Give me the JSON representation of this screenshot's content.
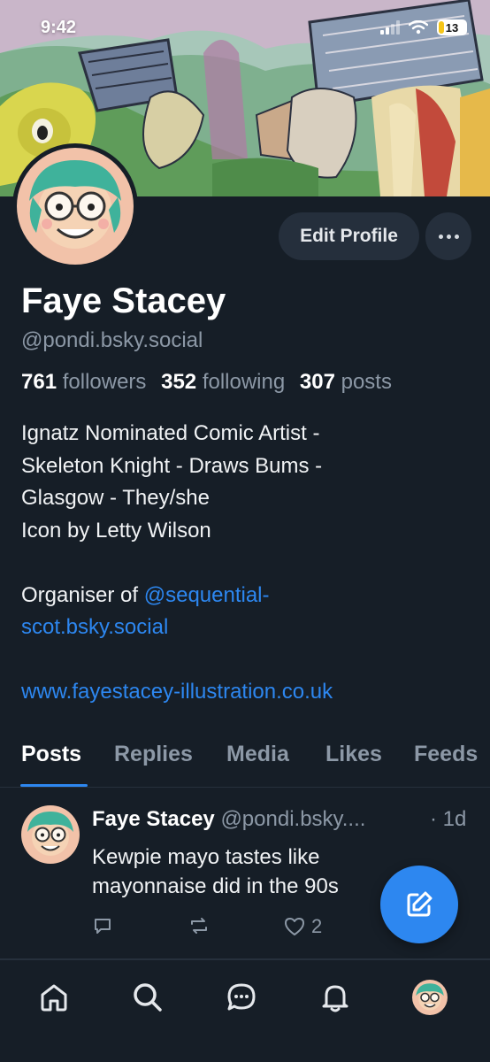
{
  "status_bar": {
    "time": "9:42",
    "battery": "13"
  },
  "profile": {
    "name": "Faye Stacey",
    "handle": "@pondi.bsky.social",
    "followers_count": "761",
    "followers_label": "followers",
    "following_count": "352",
    "following_label": "following",
    "posts_count": "307",
    "posts_label": "posts",
    "edit_button": "Edit Profile",
    "bio": {
      "line1": "Ignatz Nominated Comic Artist -",
      "line2": "Skeleton Knight - Draws Bums -",
      "line3": "Glasgow - They/she",
      "line4": "Icon by Letty Wilson",
      "organiser_prefix": "Organiser of ",
      "organiser_link_part1": "@sequential-",
      "organiser_link_part2": "scot.bsky.social",
      "website": "www.fayestacey-illustration.co.uk"
    }
  },
  "tabs": [
    {
      "label": "Posts",
      "active": true
    },
    {
      "label": "Replies"
    },
    {
      "label": "Media"
    },
    {
      "label": "Likes"
    },
    {
      "label": "Feeds"
    }
  ],
  "post": {
    "author": "Faye Stacey",
    "handle": "@pondi.bsky....",
    "time": "· 1d",
    "line1": "Kewpie mayo tastes like",
    "line2": "mayonnaise did in the 90s",
    "likes": "2"
  },
  "colors": {
    "background": "#161e27",
    "accent": "#2d87f0",
    "muted": "#8c98a6",
    "button_bg": "#252f3c"
  },
  "icons": {
    "nav": [
      "home-icon",
      "search-icon",
      "chat-icon",
      "bell-icon",
      "profile-avatar"
    ],
    "fab": "compose-icon",
    "actions": [
      "reply-icon",
      "repost-icon",
      "like-icon",
      "more-icon"
    ]
  }
}
